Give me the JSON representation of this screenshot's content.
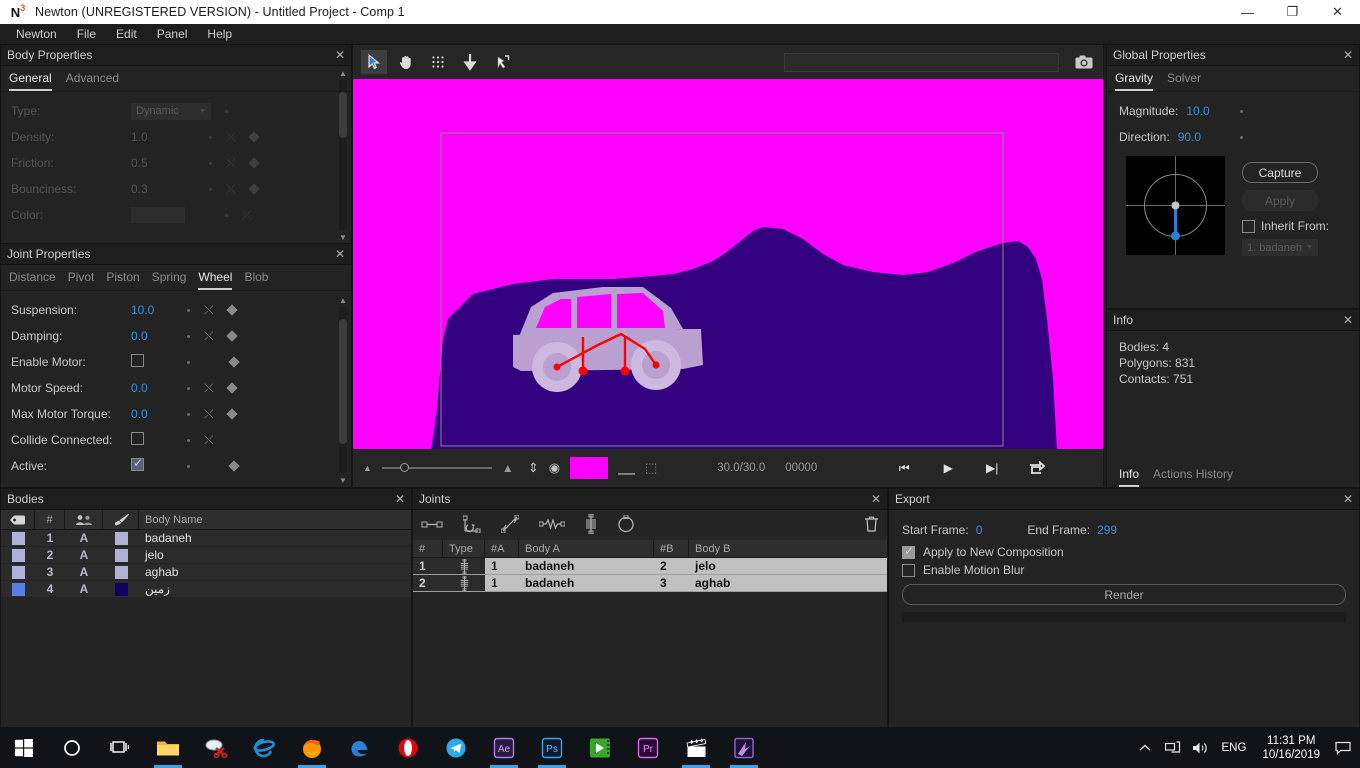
{
  "window": {
    "title": "Newton (UNREGISTERED VERSION) - Untitled Project - Comp 1",
    "logo_letter": "N",
    "logo_sup": "3",
    "minimize": "—",
    "maximize": "❐",
    "close": "✕"
  },
  "menubar": {
    "items": [
      "Newton",
      "File",
      "Edit",
      "Panel",
      "Help"
    ]
  },
  "body_properties": {
    "title": "Body Properties",
    "close": "✕",
    "tabs": [
      {
        "label": "General",
        "active": true
      },
      {
        "label": "Advanced",
        "active": false
      }
    ],
    "rows": [
      {
        "label": "Type:",
        "value": "Dynamic",
        "kind": "combo",
        "shuffle": false,
        "diamond": false
      },
      {
        "label": "Density:",
        "value": "1.0",
        "kind": "text",
        "shuffle": true,
        "diamond": true
      },
      {
        "label": "Friction:",
        "value": "0.5",
        "kind": "text",
        "shuffle": true,
        "diamond": true
      },
      {
        "label": "Bounciness:",
        "value": "0.3",
        "kind": "text",
        "shuffle": true,
        "diamond": true
      },
      {
        "label": "Color:",
        "value": "",
        "kind": "swatch",
        "shuffle": true,
        "diamond": false
      }
    ]
  },
  "joint_properties": {
    "title": "Joint Properties",
    "close": "✕",
    "tabs": [
      {
        "label": "Distance",
        "active": false
      },
      {
        "label": "Pivot",
        "active": false
      },
      {
        "label": "Piston",
        "active": false
      },
      {
        "label": "Spring",
        "active": false
      },
      {
        "label": "Wheel",
        "active": true
      },
      {
        "label": "Blob",
        "active": false
      }
    ],
    "rows": [
      {
        "label": "Suspension:",
        "value": "10.0",
        "kind": "text",
        "shuffle": true,
        "diamond": true
      },
      {
        "label": "Damping:",
        "value": "0.0",
        "kind": "text",
        "shuffle": true,
        "diamond": true
      },
      {
        "label": "Enable Motor:",
        "value": "",
        "kind": "checkbox",
        "checked": false,
        "shuffle": false,
        "diamond": true
      },
      {
        "label": "Motor Speed:",
        "value": "0.0",
        "kind": "text",
        "shuffle": true,
        "diamond": true
      },
      {
        "label": "Max Motor Torque:",
        "value": "0.0",
        "kind": "text",
        "shuffle": true,
        "diamond": true
      },
      {
        "label": "Collide Connected:",
        "value": "",
        "kind": "checkbox",
        "checked": false,
        "shuffle": true,
        "diamond": false
      },
      {
        "label": "Active:",
        "value": "",
        "kind": "checkbox",
        "checked": true,
        "shuffle": false,
        "diamond": true
      }
    ]
  },
  "bodies": {
    "title": "Bodies",
    "close": "✕",
    "columns": [
      "tag-icon",
      "#",
      "group-icon",
      "brush-icon",
      "Body Name"
    ],
    "name_column_label": "Body Name",
    "hash_column_label": "#",
    "rows": [
      {
        "num": "1",
        "group": "A",
        "name": "badaneh",
        "sel_color": "#b0b0d8",
        "body_color": "#b0b0d8"
      },
      {
        "num": "2",
        "group": "A",
        "name": "jelo",
        "sel_color": "#b0b0d8",
        "body_color": "#b0b0d8"
      },
      {
        "num": "3",
        "group": "A",
        "name": "aghab",
        "sel_color": "#b0b0d8",
        "body_color": "#b0b0d8"
      },
      {
        "num": "4",
        "group": "A",
        "name": "زمین",
        "sel_color": "#5a7fe0",
        "body_color": "#100060"
      }
    ]
  },
  "joints": {
    "title": "Joints",
    "close": "✕",
    "toolbar_icons": [
      "distance-joint-icon",
      "pivot-joint-icon",
      "piston-joint-icon",
      "spring-joint-icon",
      "wheel-joint-icon",
      "blob-joint-icon",
      "delete-joint-icon"
    ],
    "columns": [
      "#",
      "Type",
      "#A",
      "Body A",
      "#B",
      "Body B"
    ],
    "rows": [
      {
        "num": "1",
        "type": "wheel-joint-icon",
        "a_num": "1",
        "a_name": "badaneh",
        "b_num": "2",
        "b_name": "jelo"
      },
      {
        "num": "2",
        "type": "wheel-joint-icon",
        "a_num": "1",
        "a_name": "badaneh",
        "b_num": "3",
        "b_name": "aghab"
      }
    ]
  },
  "global_properties": {
    "title": "Global Properties",
    "close": "✕",
    "tabs": [
      {
        "label": "Gravity",
        "active": true
      },
      {
        "label": "Solver",
        "active": false
      }
    ],
    "magnitude_label": "Magnitude:",
    "magnitude_value": "10.0",
    "direction_label": "Direction:",
    "direction_value": "90.0",
    "capture_label": "Capture",
    "apply_label": "Apply",
    "inherit_label": "Inherit From:",
    "inherit_checked": false,
    "inherit_value": "1. badaneh"
  },
  "info": {
    "title": "Info",
    "close": "✕",
    "lines": [
      "Bodies: 4",
      "Polygons: 831",
      "Contacts: 751"
    ],
    "tabs": [
      {
        "label": "Info",
        "active": true
      },
      {
        "label": "Actions History",
        "active": false
      }
    ]
  },
  "export": {
    "title": "Export",
    "close": "✕",
    "start_frame_label": "Start Frame:",
    "start_frame_value": "0",
    "end_frame_label": "End Frame:",
    "end_frame_value": "299",
    "apply_comp_label": "Apply to New Composition",
    "apply_comp_checked": true,
    "motion_blur_label": "Enable Motion Blur",
    "motion_blur_checked": false,
    "render_label": "Render"
  },
  "viewport": {
    "tools": [
      {
        "name": "select-tool",
        "glyph": "➤",
        "active": true
      },
      {
        "name": "pan-tool",
        "glyph": "✋",
        "active": false
      },
      {
        "name": "grid-tool",
        "glyph": "⠿",
        "active": false
      },
      {
        "name": "gravity-tool",
        "glyph": "↓",
        "active": false
      },
      {
        "name": "velocity-tool",
        "glyph": "↗",
        "active": false
      }
    ],
    "search_value": "",
    "search_placeholder": "",
    "camera_icon": "camera-icon",
    "background_color": "#ff00ff",
    "terrain_color": "#33007f",
    "car_body_color": "#b9a0d0",
    "joint_color": "#ff0000"
  },
  "playback": {
    "zoom_small_icon": "zoom-out-icon",
    "zoom_large_icon": "zoom-in-icon",
    "fit_icon": "fit-to-view-icon",
    "visibility_icon": "eye-icon",
    "color_swatch": "#ff00ff",
    "onion_icon": "onion-skin-icon",
    "select_region_icon": "select-region-icon",
    "fps": "30.0/30.0",
    "frame": "00000",
    "buttons": [
      {
        "name": "go-to-start-button",
        "glyph": "⏮"
      },
      {
        "name": "play-button",
        "glyph": "▶"
      },
      {
        "name": "step-forward-button",
        "glyph": "▶|"
      },
      {
        "name": "loop-button",
        "glyph": "⟳"
      }
    ]
  },
  "taskbar": {
    "icons": [
      "windows-start-icon",
      "cortana-search-icon",
      "task-view-icon",
      "file-explorer-icon",
      "snipping-tool-icon",
      "internet-explorer-icon",
      "firefox-icon",
      "microsoft-edge-icon",
      "opera-icon",
      "telegram-icon",
      "after-effects-icon",
      "photoshop-icon",
      "media-encoder-icon",
      "premiere-pro-icon",
      "clapperboard-icon",
      "newton-icon"
    ],
    "tray": {
      "chevron": "show-hidden-icons-icon",
      "network": "network-icon",
      "volume": "volume-icon",
      "language": "ENG",
      "time": "11:31 PM",
      "date": "10/16/2019",
      "notifications": "action-center-icon"
    }
  }
}
